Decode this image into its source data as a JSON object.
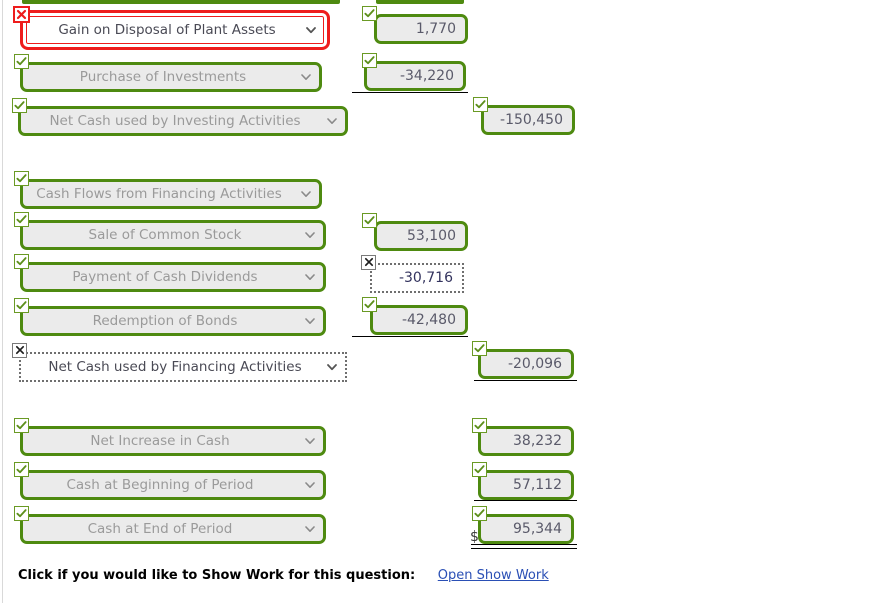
{
  "page": {
    "left_gutter": true,
    "accent_correct": "#4e8a10",
    "accent_error": "#ee1c1c",
    "field_fill": "#ebebeb",
    "placeholder_color": "#9a9a9a"
  },
  "statement": {
    "rows": [
      {
        "id": "gain-on-disposal",
        "label": "Gain on Disposal of Plant Assets",
        "label_status": "incorrect",
        "label_style": "active-error",
        "value": "1,770",
        "value_status": "correct",
        "value_column": "col1"
      },
      {
        "id": "purchase-of-investments",
        "label": "Purchase of Investments",
        "label_status": "correct",
        "label_style": "normal",
        "value": "-34,220",
        "value_status": "correct",
        "value_column": "col1"
      },
      {
        "id": "net-cash-investing",
        "label": "Net Cash used by Investing Activities",
        "label_status": "correct",
        "label_style": "normal",
        "value": "-150,450",
        "value_status": "correct",
        "value_column": "col2"
      },
      {
        "id": "cash-flows-financing-header",
        "label": "Cash Flows from Financing Activities",
        "label_status": "correct",
        "label_style": "normal",
        "value": "",
        "value_status": "none",
        "value_column": "none"
      },
      {
        "id": "sale-of-common-stock",
        "label": "Sale of Common Stock",
        "label_status": "correct",
        "label_style": "normal",
        "value": "53,100",
        "value_status": "correct",
        "value_column": "col1"
      },
      {
        "id": "payment-of-cash-dividends",
        "label": "Payment of Cash Dividends",
        "label_status": "correct",
        "label_style": "normal",
        "value": "-30,716",
        "value_status": "incorrect",
        "value_column": "col1"
      },
      {
        "id": "redemption-of-bonds",
        "label": "Redemption of Bonds",
        "label_status": "correct",
        "label_style": "normal",
        "value": "-42,480",
        "value_status": "correct",
        "value_column": "col1"
      },
      {
        "id": "net-cash-financing",
        "label": "Net Cash used by Financing Activities",
        "label_status": "incorrect",
        "label_style": "dotted",
        "value": "-20,096",
        "value_status": "correct",
        "value_column": "col2"
      },
      {
        "id": "net-increase-in-cash",
        "label": "Net Increase in Cash",
        "label_status": "correct",
        "label_style": "normal",
        "value": "38,232",
        "value_status": "correct",
        "value_column": "col2"
      },
      {
        "id": "cash-at-beginning-of-period",
        "label": "Cash at Beginning of Period",
        "label_status": "correct",
        "label_style": "normal",
        "value": "57,112",
        "value_status": "correct",
        "value_column": "col2"
      },
      {
        "id": "cash-at-end-of-period",
        "label": "Cash at End of Period",
        "label_status": "correct",
        "label_style": "normal",
        "value": "95,344",
        "value_status": "correct",
        "value_column": "col2",
        "currency_symbol": "$"
      }
    ]
  },
  "markers": {
    "correct_glyph": "✓",
    "incorrect_glyph": "✗"
  },
  "footer": {
    "prompt": "Click if you would like to Show Work for this question:",
    "link_label": "Open Show Work"
  }
}
